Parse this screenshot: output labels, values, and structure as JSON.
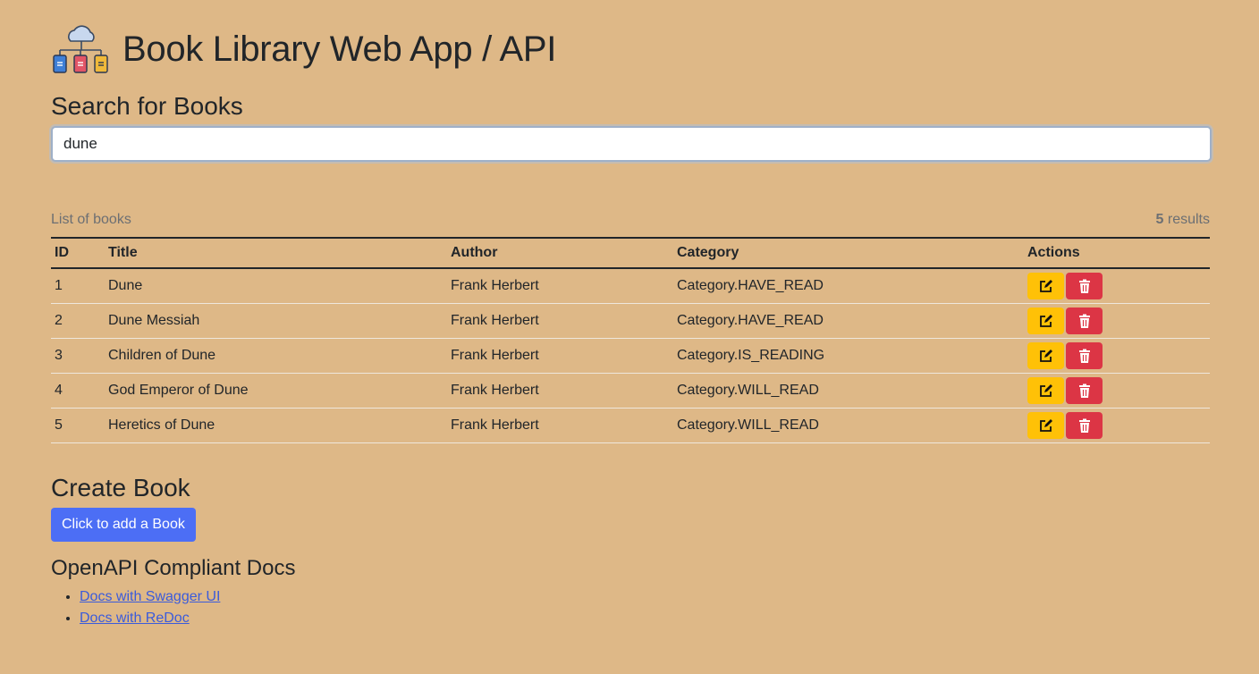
{
  "header": {
    "title": "Book Library Web App / API",
    "logo_icon": "cloud-books-network-icon"
  },
  "search": {
    "heading": "Search for Books",
    "value": "dune"
  },
  "list": {
    "caption": "List of books",
    "count": "5",
    "results_label": " results"
  },
  "table": {
    "columns": [
      "ID",
      "Title",
      "Author",
      "Category",
      "Actions"
    ],
    "rows": [
      {
        "id": "1",
        "title": "Dune",
        "author": "Frank Herbert",
        "category": "Category.HAVE_READ"
      },
      {
        "id": "2",
        "title": "Dune Messiah",
        "author": "Frank Herbert",
        "category": "Category.HAVE_READ"
      },
      {
        "id": "3",
        "title": "Children of Dune",
        "author": "Frank Herbert",
        "category": "Category.IS_READING"
      },
      {
        "id": "4",
        "title": "God Emperor of Dune",
        "author": "Frank Herbert",
        "category": "Category.WILL_READ"
      },
      {
        "id": "5",
        "title": "Heretics of Dune",
        "author": "Frank Herbert",
        "category": "Category.WILL_READ"
      }
    ]
  },
  "create": {
    "heading": "Create Book",
    "button_label": "Click to add a Book"
  },
  "docs": {
    "heading": "OpenAPI Compliant Docs",
    "links": [
      "Docs with Swagger UI",
      "Docs with ReDoc"
    ]
  },
  "colors": {
    "background": "#deb887",
    "edit": "#ffc107",
    "delete": "#dc3545",
    "primary": "#4c6ef5",
    "link": "#3b5bdb"
  }
}
